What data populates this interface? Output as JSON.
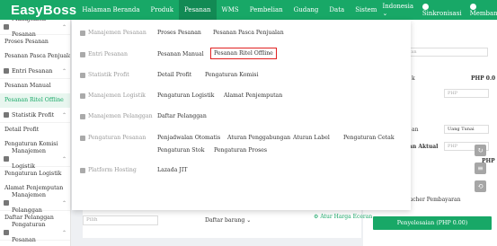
{
  "brand": {
    "logo": "EasyBoss",
    "accent": "#18a867"
  },
  "topnav": {
    "items": [
      "Halaman Beranda",
      "Produk",
      "Pesanan",
      "WMS",
      "Pembelian",
      "Gudang",
      "Data",
      "Sistem"
    ],
    "active": "Pesanan",
    "language": "Indonesia",
    "sync": "Sinkronisasi",
    "help": "Membantu"
  },
  "sidebar": {
    "groups": [
      {
        "label": "Manajemen Pesanan",
        "items": [
          "Proses Pesanan",
          "Pesanan Pasca Penjualan"
        ]
      },
      {
        "label": "Entri Pesanan",
        "items": [
          "Pesanan Manual",
          "Pesanan Ritel Offline"
        ]
      },
      {
        "label": "Statistik Profit",
        "items": [
          "Detail Profit",
          "Pengaturan Komisi"
        ]
      },
      {
        "label": "Manajemen Logistik",
        "items": [
          "Pengaturan Logistik",
          "Alamat Penjemputan"
        ]
      },
      {
        "label": "Manajemen Pelanggan",
        "items": [
          "Daftar Pelanggan"
        ]
      },
      {
        "label": "Pengaturan Pesanan",
        "items": []
      }
    ],
    "active_item": "Pesanan Ritel Offline"
  },
  "mega_menu": {
    "rows": [
      {
        "category": "Manajemen Pesanan",
        "links": [
          "Proses Pesanan",
          "Pesanan Pasca Penjualan"
        ]
      },
      {
        "category": "Entri Pesanan",
        "links": [
          "Pesanan Manual",
          "Pesanan Ritel Offline"
        ]
      },
      {
        "category": "Statistik Profit",
        "links": [
          "Detail Profit",
          "Pengaturan Komisi"
        ]
      },
      {
        "category": "Manajemen Logistik",
        "links": [
          "Pengaturan Logistik",
          "Alamat Penjemputan"
        ]
      },
      {
        "category": "Manajemen Pelanggan",
        "links": [
          "Daftar Pelanggan"
        ]
      },
      {
        "category": "Pengaturan Pesanan",
        "links": [
          "Penjadwalan Otomatis",
          "Aturan Penggabungan",
          "Aturan Label",
          "Pengaturan Cetak",
          "Pengaturan Stok",
          "Pengaturan Proses"
        ]
      },
      {
        "category": "Platform Hosting",
        "links": [
          "Lazada JIT"
        ]
      }
    ],
    "highlighted": "Pesanan Ritel Offline"
  },
  "background": {
    "gudang_placeholder": "...nggan",
    "rp_label_1": "k",
    "currency_1": "PHP 0.0",
    "input_php": "PHP",
    "uang_tunai": "Uang Tunai",
    "an_label": "an",
    "aktual_label": "an Aktual",
    "currency_2": "PHP",
    "bawah": "bawah",
    "search_placeholder": "Pilih",
    "daftar_barang": "Daftar barang",
    "atur_harga": "Atur Harga Eceran",
    "voucher": "Unggah Voucher Pembayaran",
    "pay_button": "Penyelesaian (PHP 0.00)"
  }
}
